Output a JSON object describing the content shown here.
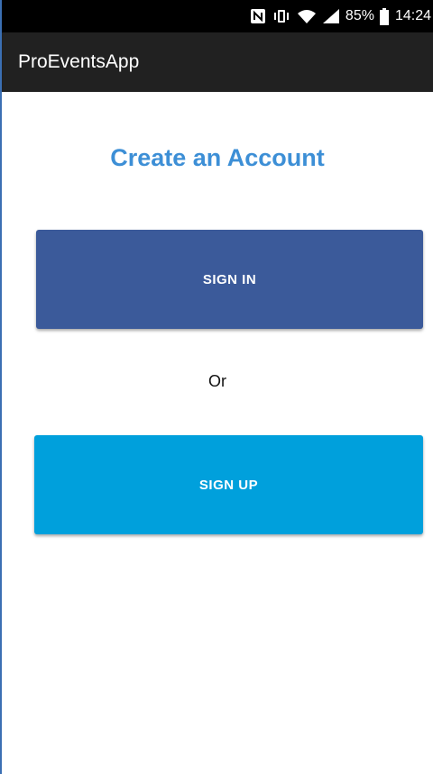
{
  "status_bar": {
    "battery": "85%",
    "time": "14:24",
    "icons": [
      "nfc-icon",
      "vibrate-icon",
      "wifi-icon",
      "signal-icon",
      "battery-icon"
    ]
  },
  "app_bar": {
    "title": "ProEventsApp"
  },
  "main": {
    "title": "Create an Account",
    "sign_in_label": "SIGN IN",
    "or_label": "Or",
    "sign_up_label": "SIGN UP"
  },
  "colors": {
    "title": "#3d8fd6",
    "sign_in_button": "#3b5a9a",
    "sign_up_button": "#00a0dc",
    "app_bar": "#212121",
    "status_bar": "#000000"
  }
}
